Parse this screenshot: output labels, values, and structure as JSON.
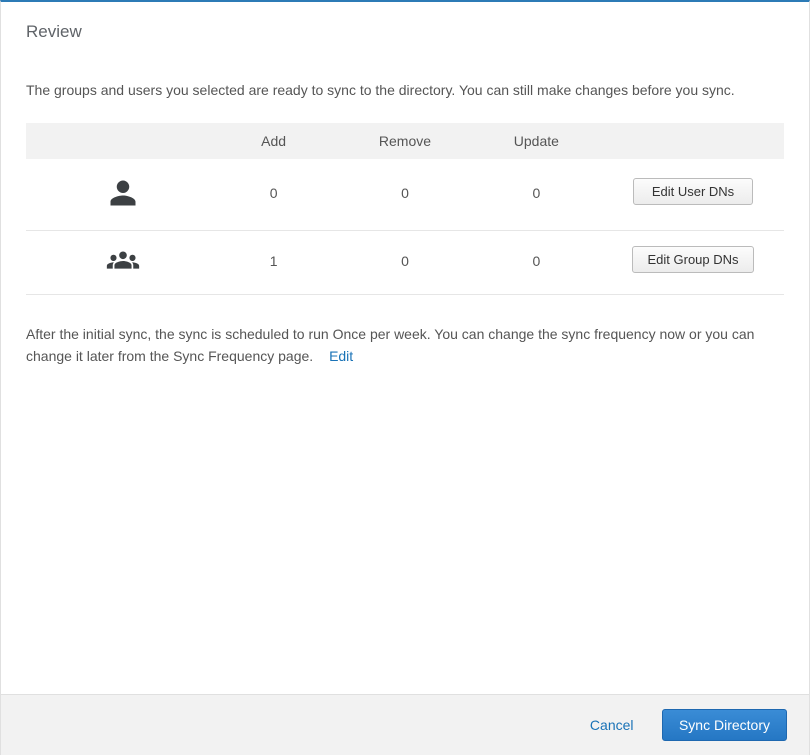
{
  "header": {
    "title": "Review"
  },
  "description": "The groups and users you selected are ready to sync to the directory. You can still make changes before you sync.",
  "table": {
    "columns": {
      "add": "Add",
      "remove": "Remove",
      "update": "Update"
    },
    "rows": {
      "users": {
        "add": "0",
        "remove": "0",
        "update": "0",
        "action_label": "Edit User DNs"
      },
      "groups": {
        "add": "1",
        "remove": "0",
        "update": "0",
        "action_label": "Edit Group DNs"
      }
    }
  },
  "schedule": {
    "text": "After the initial sync, the sync is scheduled to run Once per week. You can change the sync frequency now or you can change it later from the Sync Frequency page.",
    "edit_label": "Edit"
  },
  "footer": {
    "cancel_label": "Cancel",
    "primary_label": "Sync Directory"
  }
}
